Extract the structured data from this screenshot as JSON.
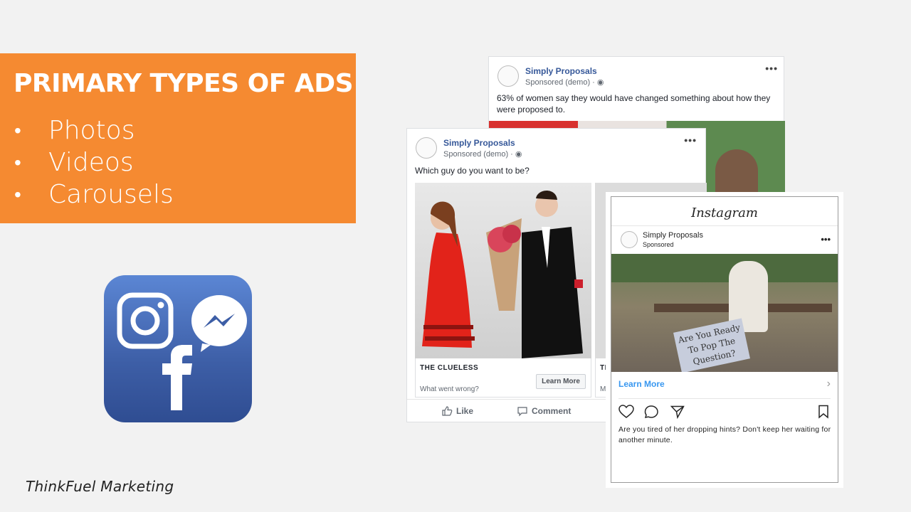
{
  "slide": {
    "title": "PRIMARY TYPES OF ADS",
    "bullets": [
      {
        "text": "Photos"
      },
      {
        "text": "Videos"
      },
      {
        "text": "Carousels"
      }
    ],
    "bullet_char": "•",
    "brand": "ThinkFuel Marketing",
    "accent_color": "#f58a31"
  },
  "app_icon": {
    "icons": [
      "instagram-icon",
      "messenger-icon",
      "facebook-icon"
    ]
  },
  "fb_back": {
    "page_name": "Simply Proposals",
    "sponsored": "Sponsored (demo) ·",
    "text": "63% of women say they would have changed something about how they were proposed to.",
    "menu": "•••"
  },
  "fb_front": {
    "page_name": "Simply Proposals",
    "sponsored": "Sponsored (demo) ·",
    "text": "Which guy do you want to be?",
    "menu": "•••",
    "cards": [
      {
        "title": "THE CLUELESS",
        "subtitle": "What went wrong?",
        "button": "Learn More"
      },
      {
        "title": "TI",
        "subtitle": "M"
      }
    ],
    "actions": {
      "like": "Like",
      "comment": "Comment"
    }
  },
  "instagram": {
    "logo": "Instagram",
    "page_name": "Simply Proposals",
    "sponsored": "Sponsored",
    "menu": "•••",
    "sign_text": "Are You Ready To Pop The Question?",
    "cta": "Learn More",
    "caption": "Are you tired of her dropping hints? Don't keep her waiting for another minute."
  }
}
